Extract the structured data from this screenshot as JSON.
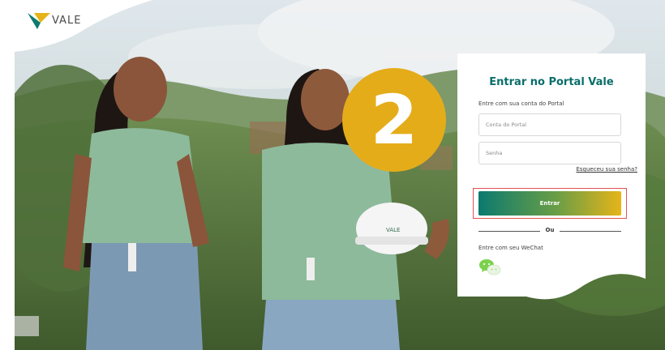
{
  "brand": {
    "name": "VALE"
  },
  "login": {
    "title": "Entrar no Portal Vale",
    "subtitle": "Entre com sua conta do Portal",
    "account_placeholder": "Conta do Portal",
    "password_placeholder": "Senha",
    "forgot_link": "Esqueceu sua senha?",
    "submit_label": "Entrar",
    "or_label": "Ou",
    "wechat_label": "Entre com seu WeChat"
  },
  "badge": {
    "number": "2",
    "color": "#e5ac1a"
  },
  "colors": {
    "brand_teal": "#0a6e6a",
    "brand_yellow": "#e6b419",
    "highlight_red": "#e05353",
    "wechat_green": "#7bd24c"
  },
  "photo": {
    "icons": [
      "helmet-icon",
      "lanyard-icon"
    ],
    "helmet_text": "VALE"
  }
}
